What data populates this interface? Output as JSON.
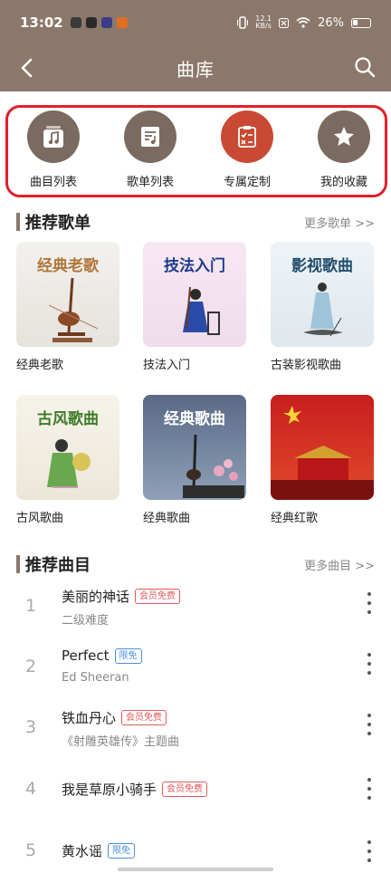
{
  "status": {
    "time": "13:02",
    "net_speed_top": "12.1",
    "net_speed_bottom": "KB/s",
    "battery": "26%"
  },
  "nav": {
    "title": "曲库"
  },
  "quick": [
    {
      "label": "曲目列表",
      "icon": "music-note-icon"
    },
    {
      "label": "歌单列表",
      "icon": "playlist-icon"
    },
    {
      "label": "专属定制",
      "icon": "checklist-icon"
    },
    {
      "label": "我的收藏",
      "icon": "star-icon"
    }
  ],
  "playlists": {
    "title": "推荐歌单",
    "more": "更多歌单 >>",
    "items": [
      {
        "label": "经典老歌",
        "img_title": "经典老歌"
      },
      {
        "label": "技法入门",
        "img_title": "技法入门"
      },
      {
        "label": "古装影视歌曲",
        "img_title": "影视歌曲"
      },
      {
        "label": "古风歌曲",
        "img_title": "古风歌曲"
      },
      {
        "label": "经典歌曲",
        "img_title": "经典歌曲"
      },
      {
        "label": "经典红歌",
        "img_title": ""
      }
    ]
  },
  "songs": {
    "title": "推荐曲目",
    "more": "更多曲目 >>",
    "items": [
      {
        "num": "1",
        "title": "美丽的神话",
        "tag": "会员免费",
        "sub": "二级难度"
      },
      {
        "num": "2",
        "title": "Perfect",
        "tag": "限免",
        "sub": "Ed Sheeran"
      },
      {
        "num": "3",
        "title": "铁血丹心",
        "tag": "会员免费",
        "sub": "《射雕英雄传》主题曲"
      },
      {
        "num": "4",
        "title": "我是草原小骑手",
        "tag": "会员免费",
        "sub": ""
      },
      {
        "num": "5",
        "title": "黄水谣",
        "tag": "限免",
        "sub": ""
      }
    ]
  }
}
